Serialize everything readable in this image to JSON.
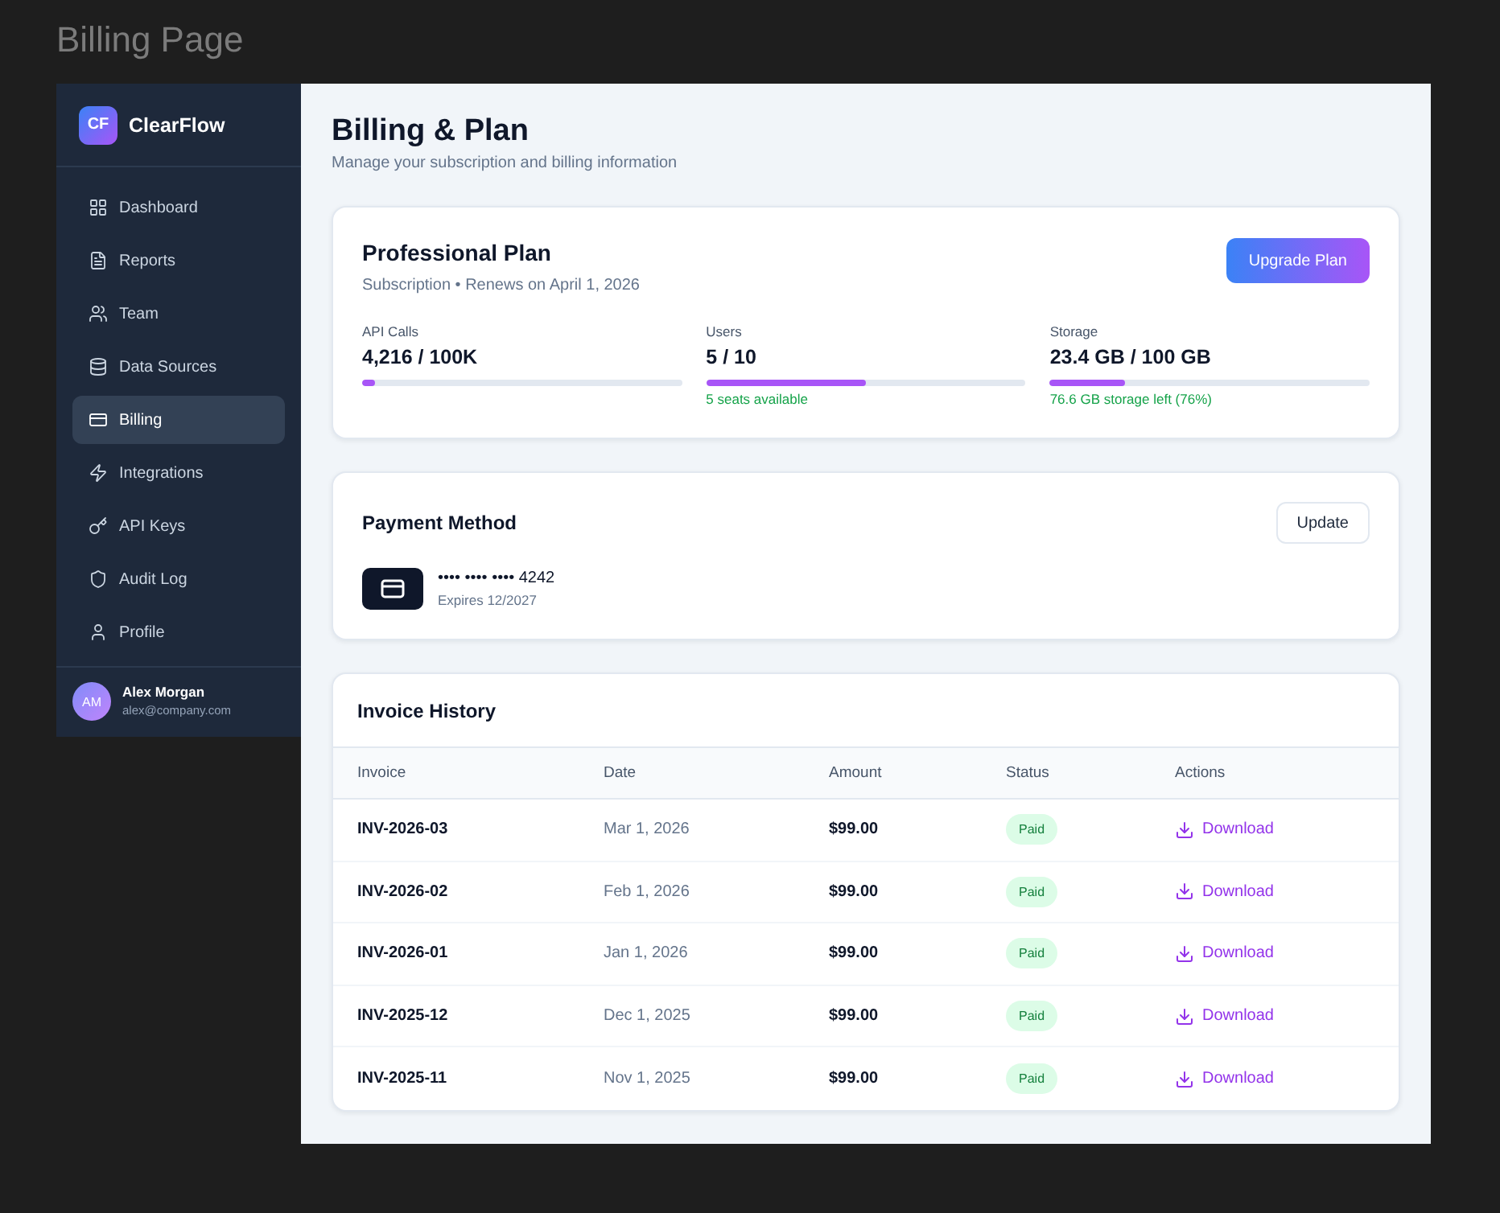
{
  "page_title": "Billing Page",
  "sidebar": {
    "logo": {
      "initials": "CF",
      "name": "ClearFlow"
    },
    "items": [
      {
        "label": "Dashboard",
        "selected": false
      },
      {
        "label": "Reports",
        "selected": false
      },
      {
        "label": "Team",
        "selected": false
      },
      {
        "label": "Data Sources",
        "selected": false
      },
      {
        "label": "Billing",
        "selected": true
      },
      {
        "label": "Integrations",
        "selected": false
      },
      {
        "label": "API Keys",
        "selected": false
      },
      {
        "label": "Audit Log",
        "selected": false
      },
      {
        "label": "Profile",
        "selected": false
      }
    ],
    "user": {
      "initials": "AM",
      "name": "Alex Morgan",
      "email": "alex@company.com"
    }
  },
  "header": {
    "title": "Billing & Plan",
    "subtitle": "Manage your subscription and billing information"
  },
  "plan": {
    "name": "Professional Plan",
    "subtitle": "Subscription • Renews on April 1, 2026",
    "button": "Upgrade Plan",
    "metrics": [
      {
        "label": "API Calls",
        "value": "4,216 / 100K",
        "level": 0.04
      },
      {
        "label": "Users",
        "value": "5 / 10",
        "level": 0.5,
        "note": "5 seats available"
      },
      {
        "label": "Storage",
        "value": "23.4 GB / 100 GB",
        "level": 0.234,
        "note": "76.6 GB storage left (76%)"
      }
    ]
  },
  "payment": {
    "title": "Payment Method",
    "button": "Update",
    "card_number": "•••• •••• •••• 4242",
    "expiry": "Expires 12/2027"
  },
  "invoices": {
    "title": "Invoice History",
    "columns": [
      "Invoice",
      "Date",
      "Amount",
      "Status",
      "Actions"
    ],
    "rows": [
      {
        "invoice": "INV-2026-03",
        "date": "Mar 1, 2026",
        "amount": "$99.00",
        "status": "Paid",
        "action": "Download"
      },
      {
        "invoice": "INV-2026-02",
        "date": "Feb 1, 2026",
        "amount": "$99.00",
        "status": "Paid",
        "action": "Download"
      },
      {
        "invoice": "INV-2026-01",
        "date": "Jan 1, 2026",
        "amount": "$99.00",
        "status": "Paid",
        "action": "Download"
      },
      {
        "invoice": "INV-2025-12",
        "date": "Dec 1, 2025",
        "amount": "$99.00",
        "status": "Paid",
        "action": "Download"
      },
      {
        "invoice": "INV-2025-11",
        "date": "Nov 1, 2025",
        "amount": "$99.00",
        "status": "Paid",
        "action": "Download"
      }
    ]
  }
}
